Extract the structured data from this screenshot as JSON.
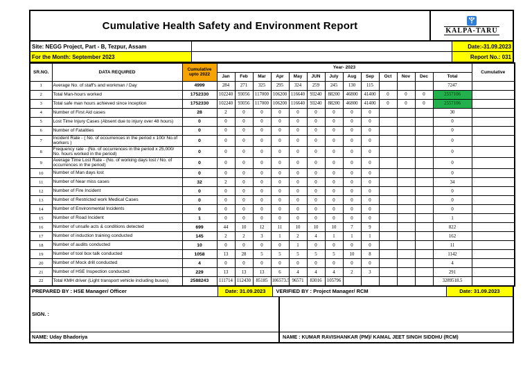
{
  "colors": {
    "yellow": "#FFFF00",
    "orange": "#F6A400",
    "green": "#22B14C",
    "logo_blue": "#2F7ED8"
  },
  "header": {
    "title": "Cumulative Health Safety and Environment Report",
    "brand": "KALPA-TARU"
  },
  "info": {
    "site": "Site: NEGG Project, Part - B, Tezpur, Assam",
    "date": "Date:-31.09.2023",
    "month": "For the Month: September 2023",
    "report_no": "Report No.: 031"
  },
  "table": {
    "h_sr": "SR.NO.",
    "h_data": "DATA REQUIRED",
    "h_cum2022": "Cumulative upto 2022",
    "h_year": "Year- 2023",
    "h_cumulative": "Cumulative",
    "months": [
      "Jan",
      "Feb",
      "Mar",
      "Apr",
      "May",
      "JUN",
      "July",
      "Aug",
      "Sep",
      "Oct",
      "Nov",
      "Dec",
      "Total"
    ],
    "rows": [
      {
        "sr": "1",
        "label": "Average No. of staff's and workman / Day",
        "cum": "4999",
        "vals": [
          "284",
          "271",
          "325",
          "295",
          "324",
          "259",
          "245",
          "130",
          "115",
          "",
          "",
          ""
        ],
        "total": "7247",
        "hl": false
      },
      {
        "sr": "2",
        "label": "Total Man-hours worked",
        "cum": "1752330",
        "vals": [
          "102240",
          "93056",
          "117000",
          "106200",
          "116640",
          "93240",
          "88200",
          "46800",
          "41400",
          "0",
          "0",
          "0"
        ],
        "total": "2557106",
        "hl": true
      },
      {
        "sr": "3",
        "label": "Total safe man hours achieved since inception",
        "cum": "1752330",
        "vals": [
          "102240",
          "93056",
          "117000",
          "106200",
          "116640",
          "93240",
          "88200",
          "46800",
          "41400",
          "0",
          "0",
          "0"
        ],
        "total": "2557106",
        "hl": true
      },
      {
        "sr": "4",
        "label": "Number of First Aid cases",
        "cum": "28",
        "vals": [
          "2",
          "0",
          "0",
          "0",
          "0",
          "0",
          "0",
          "0",
          "0",
          "",
          "",
          ""
        ],
        "total": "30",
        "hl": false
      },
      {
        "sr": "5",
        "label": "Lost Time Injury Cases (Absent due to injury over 48 hours)",
        "cum": "0",
        "vals": [
          "0",
          "0",
          "0",
          "0",
          "0",
          "0",
          "0",
          "0",
          "0",
          "",
          "",
          ""
        ],
        "total": "0",
        "hl": false
      },
      {
        "sr": "6",
        "label": "Number of Fatalities",
        "cum": "0",
        "vals": [
          "0",
          "0",
          "0",
          "0",
          "0",
          "0",
          "0",
          "0",
          "0",
          "",
          "",
          ""
        ],
        "total": "0",
        "hl": false
      },
      {
        "sr": "7",
        "label": "Incident Rate - ( No. of occurrences in the period x 100/ No.of workers )",
        "cum": "0",
        "vals": [
          "0",
          "0",
          "0",
          "0",
          "0",
          "0",
          "0",
          "0",
          "0",
          "",
          "",
          ""
        ],
        "total": "0",
        "hl": false
      },
      {
        "sr": "8",
        "label": "Frequency rate - (No. of occurrences in the period x 25,000/ No. hours worked in the period)",
        "cum": "0",
        "vals": [
          "0",
          "0",
          "0",
          "0",
          "0",
          "0",
          "0",
          "0",
          "0",
          "",
          "",
          ""
        ],
        "total": "0",
        "hl": false
      },
      {
        "sr": "9",
        "label": "Average Time Lost Rate - (No. of working days lost / No. of occurrences in the period)",
        "cum": "0",
        "vals": [
          "0",
          "0",
          "0",
          "0",
          "0",
          "0",
          "0",
          "0",
          "0",
          "",
          "",
          ""
        ],
        "total": "0",
        "hl": false
      },
      {
        "sr": "10",
        "label": "Number of Man days lost",
        "cum": "0",
        "vals": [
          "0",
          "0",
          "0",
          "0",
          "0",
          "0",
          "0",
          "0",
          "0",
          "",
          "",
          ""
        ],
        "total": "0",
        "hl": false
      },
      {
        "sr": "11",
        "label": "Number of Near miss cases",
        "cum": "32",
        "vals": [
          "2",
          "0",
          "0",
          "0",
          "0",
          "0",
          "0",
          "0",
          "0",
          "",
          "",
          ""
        ],
        "total": "34",
        "hl": false
      },
      {
        "sr": "12",
        "label": "Number of Fire Incident",
        "cum": "0",
        "vals": [
          "0",
          "0",
          "0",
          "0",
          "0",
          "0",
          "0",
          "0",
          "0",
          "",
          "",
          ""
        ],
        "total": "0",
        "hl": false
      },
      {
        "sr": "13",
        "label": "Number of Restricted work Medical Cases",
        "cum": "0",
        "vals": [
          "0",
          "0",
          "0",
          "0",
          "0",
          "0",
          "0",
          "0",
          "0",
          "",
          "",
          ""
        ],
        "total": "0",
        "hl": false
      },
      {
        "sr": "14",
        "label": "Number of Environmental Incidents",
        "cum": "0",
        "vals": [
          "0",
          "0",
          "0",
          "0",
          "0",
          "0",
          "0",
          "0",
          "0",
          "",
          "",
          ""
        ],
        "total": "0",
        "hl": false
      },
      {
        "sr": "15",
        "label": "Number of Road Incident",
        "cum": "1",
        "vals": [
          "0",
          "0",
          "0",
          "0",
          "0",
          "0",
          "0",
          "0",
          "0",
          "",
          "",
          ""
        ],
        "total": "1",
        "hl": false
      },
      {
        "sr": "16",
        "label": "Number of unsafe acts & conditions detected",
        "cum": "699",
        "vals": [
          "44",
          "10",
          "12",
          "11",
          "10",
          "10",
          "10",
          "7",
          "9",
          "",
          "",
          ""
        ],
        "total": "822",
        "hl": false
      },
      {
        "sr": "17",
        "label": "Number of induction training conducted",
        "cum": "145",
        "vals": [
          "2",
          "2",
          "3",
          "1",
          "2",
          "4",
          "1",
          "1",
          "1",
          "",
          "",
          ""
        ],
        "total": "162",
        "hl": false
      },
      {
        "sr": "18",
        "label": "Number of audits conducted",
        "cum": "10",
        "vals": [
          "0",
          "0",
          "0",
          "0",
          "1",
          "0",
          "0",
          "0",
          "0",
          "",
          "",
          ""
        ],
        "total": "11",
        "hl": false
      },
      {
        "sr": "19",
        "label": "Number of tool box talk conducted",
        "cum": "1058",
        "vals": [
          "13",
          "28",
          "5",
          "5",
          "5",
          "5",
          "5",
          "10",
          "8",
          "",
          "",
          ""
        ],
        "total": "1142",
        "hl": false
      },
      {
        "sr": "20",
        "label": "Number of Mock drill conducted",
        "cum": "4",
        "vals": [
          "0",
          "0",
          "0",
          "0",
          "0",
          "0",
          "0",
          "0",
          "0",
          "",
          "",
          ""
        ],
        "total": "4",
        "hl": false
      },
      {
        "sr": "21",
        "label": "Number of HSE Inspection conducted",
        "cum": "229",
        "vals": [
          "13",
          "13",
          "13",
          "6",
          "4",
          "4",
          "4",
          "2",
          "3",
          "",
          "",
          ""
        ],
        "total": "291",
        "hl": false
      },
      {
        "sr": "22",
        "label": "Total KMH driver (Light transport vehicle including buses)",
        "cum": "2588243",
        "vals": [
          "111714",
          "112430",
          "85185",
          "106573.5",
          "96571",
          "83016",
          "105796",
          "",
          "",
          "",
          "",
          ""
        ],
        "total": "3289518.5",
        "hl": false
      }
    ]
  },
  "footer": {
    "prepared_by": "PREPARED BY : HSE Manager/ Officer",
    "prepared_date": "Date: 31.09.2023",
    "verified_by": "VERIFIED BY :   Project Manager/ RCM",
    "verified_date": "Date: 31.09.2023",
    "sign_label": "SIGN. :",
    "name_left": "NAME: Uday Bhadoriya",
    "name_right": "NAME : KUMAR RAVISHANKAR (PM)/ KAMAL JEET SINGH SIDDHU (RCM)"
  }
}
